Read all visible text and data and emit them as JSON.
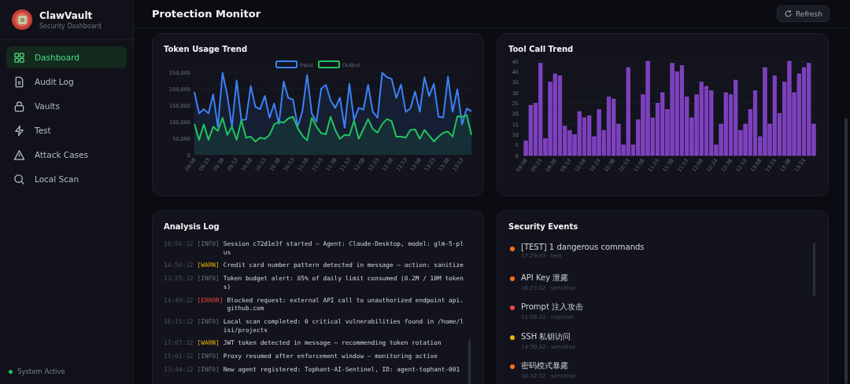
{
  "sidebar": {
    "brand": {
      "title": "ClawVault",
      "subtitle": "Security Dashboard"
    },
    "items": [
      {
        "label": "Dashboard",
        "kind": "grid",
        "selected": true
      },
      {
        "label": "Audit Log",
        "kind": "file",
        "selected": false
      },
      {
        "label": "Vaults",
        "kind": "lock",
        "selected": false
      },
      {
        "label": "Test",
        "kind": "bolt",
        "selected": false
      },
      {
        "label": "Attack Cases",
        "kind": "warning",
        "selected": false
      },
      {
        "label": "Local Scan",
        "kind": "search",
        "selected": false
      }
    ],
    "status": {
      "label": "System Active",
      "color": "#22c55e"
    }
  },
  "header": {
    "title": "Protection Monitor",
    "refresh_button": "Refresh"
  },
  "token_chart": {
    "title": "Token Usage Trend",
    "chart_data": {
      "type": "area",
      "grid": true,
      "legend": true,
      "categories": [
        "09:08",
        null,
        null,
        "09:23",
        null,
        null,
        "09:38",
        null,
        null,
        "09:53",
        null,
        null,
        "10:08",
        null,
        null,
        "10:23",
        null,
        null,
        "10:38",
        null,
        null,
        "10:53",
        null,
        null,
        "11:08",
        null,
        null,
        "11:23",
        null,
        null,
        "11:38",
        null,
        null,
        "11:53",
        null,
        null,
        "12:08",
        null,
        null,
        "12:23",
        null,
        null,
        "12:38",
        null,
        null,
        "12:53",
        null,
        null,
        "13:08",
        null,
        null,
        "13:23",
        null,
        null,
        "13:38",
        null,
        null,
        "13:53",
        null,
        null
      ],
      "ylim": [
        0,
        250000
      ],
      "yticks": [
        {
          "value": 0,
          "label": "0"
        },
        {
          "value": 50000,
          "label": "50,000"
        },
        {
          "value": 100000,
          "label": "100,000"
        },
        {
          "value": 150000,
          "label": "150,000"
        },
        {
          "value": 200000,
          "label": "200,000"
        },
        {
          "value": 250000,
          "label": "250,000"
        }
      ],
      "series": [
        {
          "name": "Input",
          "color": "#3b82f6",
          "values": [
            190000,
            125000,
            138000,
            125000,
            183000,
            85000,
            248000,
            180000,
            85000,
            225000,
            105000,
            107000,
            208000,
            145000,
            138000,
            178000,
            112000,
            155000,
            93000,
            222000,
            172000,
            167000,
            85000,
            132000,
            242000,
            125000,
            100000,
            200000,
            212000,
            165000,
            142000,
            173000,
            82000,
            215000,
            105000,
            142000,
            137000,
            212000,
            130000,
            112000,
            248000,
            235000,
            230000,
            172000,
            213000,
            130000,
            140000,
            192000,
            130000,
            235000,
            178000,
            215000,
            115000,
            113000,
            237000,
            130000,
            198000,
            92000,
            140000,
            132000
          ]
        },
        {
          "name": "Output",
          "color": "#22c55e",
          "values": [
            93000,
            45000,
            92000,
            45000,
            85000,
            72000,
            112000,
            60000,
            85000,
            45000,
            105000,
            52000,
            55000,
            40000,
            52000,
            48000,
            60000,
            92000,
            100000,
            97000,
            110000,
            115000,
            80000,
            58000,
            43000,
            112000,
            85000,
            65000,
            62000,
            115000,
            75000,
            48000,
            60000,
            58000,
            103000,
            48000,
            78000,
            108000,
            78000,
            67000,
            93000,
            108000,
            102000,
            55000,
            55000,
            52000,
            75000,
            77000,
            48000,
            75000,
            58000,
            40000,
            55000,
            67000,
            70000,
            55000,
            117000,
            115000,
            120000,
            60000
          ]
        }
      ]
    }
  },
  "tool_chart": {
    "title": "Tool Call Trend",
    "chart_data": {
      "type": "bar",
      "grid": true,
      "categories": [
        "09:08",
        null,
        null,
        "09:23",
        null,
        null,
        "09:38",
        null,
        null,
        "09:53",
        null,
        null,
        "10:08",
        null,
        null,
        "10:23",
        null,
        null,
        "10:38",
        null,
        null,
        "10:53",
        null,
        null,
        "11:08",
        null,
        null,
        "11:23",
        null,
        null,
        "11:38",
        null,
        null,
        "11:53",
        null,
        null,
        "12:08",
        null,
        null,
        "12:23",
        null,
        null,
        "12:38",
        null,
        null,
        "12:53",
        null,
        null,
        "13:08",
        null,
        null,
        "13:23",
        null,
        null,
        "13:38",
        null,
        null,
        "13:53",
        null,
        null
      ],
      "ylim": [
        0,
        45
      ],
      "yticks": [
        0,
        5,
        10,
        15,
        20,
        25,
        30,
        35,
        40,
        45
      ],
      "series": [
        {
          "color": "#7e3fbf",
          "values": [
            7,
            24,
            25,
            44,
            8,
            35,
            39,
            38,
            14,
            12,
            10,
            21,
            18,
            19,
            9,
            22,
            12,
            28,
            27,
            15,
            5,
            42,
            5,
            17,
            29,
            45,
            18,
            25,
            30,
            22,
            44,
            40,
            43,
            28,
            18,
            29,
            35,
            33,
            31,
            5,
            15,
            30,
            29,
            36,
            12,
            15,
            22,
            31,
            9,
            42,
            15,
            38,
            20,
            35,
            45,
            30,
            39,
            42,
            44,
            15
          ]
        }
      ]
    }
  },
  "analysis_log": {
    "title": "Analysis Log",
    "entries": [
      {
        "time": "16:56:32",
        "level": "[INFO]",
        "kind": "info",
        "message": "Session c72d1e3f started — Agent: Claude-Desktop, model: glm-5-plus"
      },
      {
        "time": "14:50:32",
        "level": "[WARN]",
        "kind": "warn",
        "message": "Credit card number pattern detected in message — action: sanitize"
      },
      {
        "time": "13:25:32",
        "level": "[INFO]",
        "kind": "info",
        "message": "Token budget alert: 85% of daily limit consumed (8.2M / 10M tokens)"
      },
      {
        "time": "14:49:32",
        "level": "[ERROR]",
        "kind": "error",
        "message": "Blocked request: external API call to unauthorized endpoint api.github.com"
      },
      {
        "time": "16:15:32",
        "level": "[INFO]",
        "kind": "info",
        "message": "Local scan completed: 0 critical vulnerabilities found in /home/lisi/projects"
      },
      {
        "time": "17:07:32",
        "level": "[WARN]",
        "kind": "warn",
        "message": "JWT token detected in message — recommending token rotation"
      },
      {
        "time": "15:01:32",
        "level": "[INFO]",
        "kind": "info",
        "message": "Proxy resumed after enforcement window — monitoring active"
      },
      {
        "time": "13:44:32",
        "level": "[INFO]",
        "kind": "info",
        "message": "New agent registered: Tophant-AI-Sentinel, ID: agent-tophant-001"
      }
    ]
  },
  "security_events": {
    "title": "Security Events",
    "events": [
      {
        "title": "[TEST] 1 dangerous commands",
        "meta": "17:29:43 · test",
        "color": "#f97316"
      },
      {
        "title": "API Key 泄露",
        "meta": "16:23:32 · sensitive",
        "color": "#f97316"
      },
      {
        "title": "Prompt 注入攻击",
        "meta": "11:08:32 · injection",
        "color": "#ef4444"
      },
      {
        "title": "SSH 私钥访问",
        "meta": "14:30:32 · sensitive",
        "color": "#eab308"
      },
      {
        "title": "密码模式暴露",
        "meta": "10:42:32 · sensitive",
        "color": "#f97316"
      }
    ]
  }
}
